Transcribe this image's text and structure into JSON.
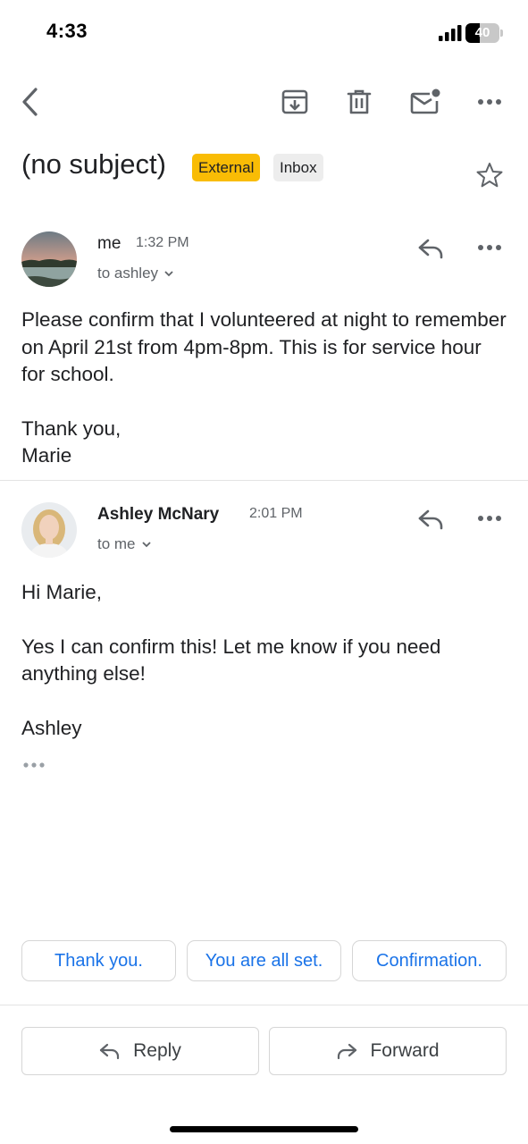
{
  "status_bar": {
    "time": "4:33",
    "battery": "40"
  },
  "toolbar": {
    "back_icon": "chevron-left-icon",
    "archive_icon": "archive-icon",
    "delete_icon": "trash-icon",
    "mark_unread_icon": "mail-unread-icon",
    "more_icon": "more-horizontal-icon"
  },
  "subject": {
    "title": "(no subject)",
    "labels": [
      "External",
      "Inbox"
    ],
    "star_icon": "star-outline-icon"
  },
  "messages": [
    {
      "sender": "me",
      "time": "1:32 PM",
      "recipient": "to ashley",
      "body": [
        "Please confirm that I volunteered at night to remember on April 21st from 4pm-8pm. This is for service hour for school.",
        "Thank you,",
        "Marie"
      ]
    },
    {
      "sender": "Ashley McNary",
      "time": "2:01 PM",
      "recipient": "to me",
      "body": [
        "Hi Marie,",
        "Yes I can confirm this! Let me know if you need anything else!",
        "Ashley"
      ]
    }
  ],
  "smart_replies": [
    "Thank you.",
    "You are all set.",
    "Confirmation."
  ],
  "actions": {
    "reply": "Reply",
    "forward": "Forward"
  },
  "colors": {
    "accent": "#1a73e8",
    "external_chip": "#f9bc05",
    "inbox_chip": "#ededed"
  }
}
